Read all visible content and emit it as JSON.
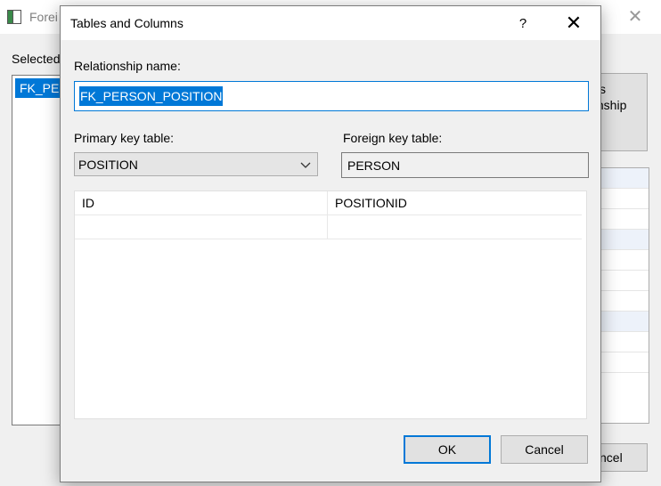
{
  "background_window": {
    "title": "Forei",
    "selected_label": "Selected",
    "list_item": "FK_PER",
    "right_button_lines": [
      "s",
      "ionship"
    ],
    "cancel_label": "ncel"
  },
  "dialog": {
    "title": "Tables and Columns",
    "help_glyph": "?",
    "close_glyph": "✕",
    "relationship_name_label": "Relationship name:",
    "relationship_name_value": "FK_PERSON_POSITION",
    "primary_key_label": "Primary key table:",
    "primary_key_value": "POSITION",
    "foreign_key_label": "Foreign key table:",
    "foreign_key_value": "PERSON",
    "columns": [
      {
        "primary": "ID",
        "foreign": "POSITIONID"
      },
      {
        "primary": "",
        "foreign": ""
      }
    ],
    "ok_label": "OK",
    "cancel_label": "Cancel"
  },
  "colors": {
    "accent": "#0078d7",
    "selection_text": "#ffffff"
  },
  "icons": {
    "app_icon": "window-icon",
    "dropdown": "chevron-down-icon"
  }
}
